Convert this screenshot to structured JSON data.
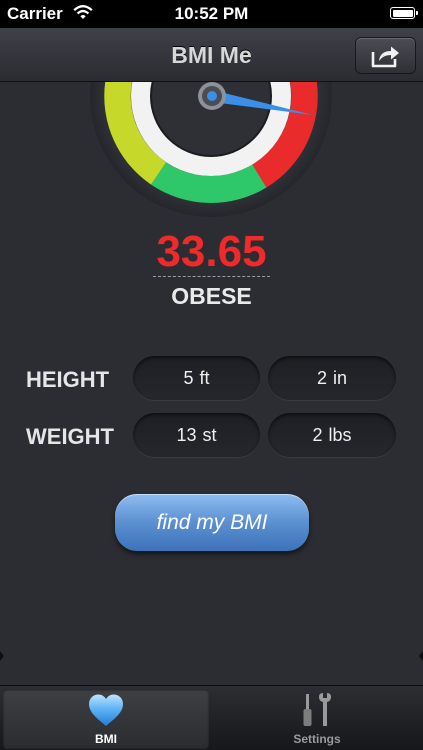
{
  "status_bar": {
    "carrier": "Carrier",
    "time": "10:52 PM"
  },
  "nav": {
    "title": "BMI Me",
    "share_icon": "share-icon"
  },
  "gauge": {
    "zones": [
      "yellow-green",
      "green",
      "red"
    ],
    "colors": {
      "yellow_green": "#c6d82a",
      "green": "#2ec86a",
      "red": "#e92b2b",
      "needle": "#3a8fe8"
    }
  },
  "result": {
    "bmi": "33.65",
    "category": "OBESE",
    "color": "#ee2a2a"
  },
  "form": {
    "height_label": "HEIGHT",
    "weight_label": "WEIGHT",
    "height_ft": "5",
    "height_ft_unit": "ft",
    "height_in": "2",
    "height_in_unit": "in",
    "weight_st": "13",
    "weight_st_unit": "st",
    "weight_lbs": "2",
    "weight_lbs_unit": "lbs"
  },
  "action": {
    "find_label": "find my BMI",
    "color": "#5a8fd0"
  },
  "tabs": [
    {
      "label": "BMI",
      "icon": "heart-icon",
      "selected": true
    },
    {
      "label": "Settings",
      "icon": "tools-icon",
      "selected": false
    }
  ]
}
